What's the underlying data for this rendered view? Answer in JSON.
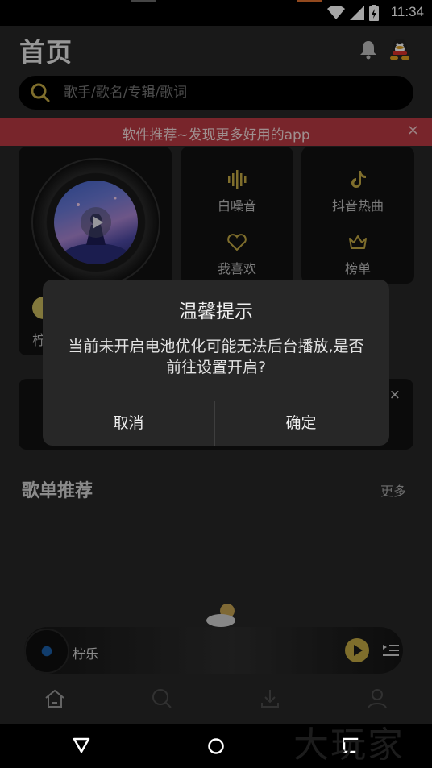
{
  "status_bar": {
    "time": "11:34"
  },
  "header": {
    "title": "首页"
  },
  "search": {
    "placeholder": "歌手/歌名/专辑/歌词"
  },
  "promo": {
    "text": "软件推荐~发现更多好用的app",
    "close": "×"
  },
  "features": [
    {
      "label": "白噪音",
      "icon": "sound-wave-icon"
    },
    {
      "label": "抖音热曲",
      "icon": "tiktok-icon"
    },
    {
      "label": "我喜欢",
      "icon": "heart-icon"
    },
    {
      "label": "榜单",
      "icon": "crown-icon"
    }
  ],
  "vinyl_card": {
    "label_partial": "柠"
  },
  "strip": {
    "close": "×"
  },
  "section": {
    "title": "歌单推荐",
    "more": "更多"
  },
  "player": {
    "title": "柠乐"
  },
  "dialog": {
    "title": "温馨提示",
    "message": "当前未开启电池优化可能无法后台播放,是否前往设置开启?",
    "cancel": "取消",
    "confirm": "确定"
  },
  "watermark": "大玩家",
  "colors": {
    "background": "#272727",
    "promo": "#b83a43",
    "accent": "#c3a944",
    "scrim": "rgba(0,0,0,0.35)"
  }
}
